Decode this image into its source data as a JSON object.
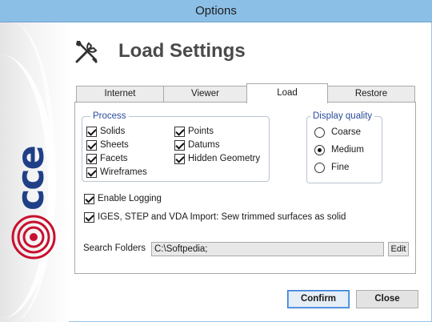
{
  "window": {
    "title": "Options"
  },
  "header": {
    "title": "Load Settings",
    "icon": "tools-icon"
  },
  "tabs": [
    {
      "label": "Internet",
      "active": false
    },
    {
      "label": "Viewer",
      "active": false
    },
    {
      "label": "Load",
      "active": true
    },
    {
      "label": "Restore",
      "active": false
    }
  ],
  "process": {
    "legend": "Process",
    "items": [
      {
        "label": "Solids",
        "checked": true
      },
      {
        "label": "Sheets",
        "checked": true
      },
      {
        "label": "Facets",
        "checked": true
      },
      {
        "label": "Wireframes",
        "checked": true
      },
      {
        "label": "Points",
        "checked": true
      },
      {
        "label": "Datums",
        "checked": true
      },
      {
        "label": "Hidden Geometry",
        "checked": true
      }
    ]
  },
  "display_quality": {
    "legend": "Display quality",
    "options": [
      {
        "label": "Coarse",
        "selected": false
      },
      {
        "label": "Medium",
        "selected": true
      },
      {
        "label": "Fine",
        "selected": false
      }
    ]
  },
  "options": {
    "enable_logging": {
      "label": "Enable Logging",
      "checked": true
    },
    "sew_trimmed": {
      "label": "IGES, STEP and VDA Import: Sew trimmed surfaces as solid",
      "checked": true
    }
  },
  "search": {
    "label": "Search Folders",
    "value": "C:\\Softpedia;",
    "edit_label": "Edit"
  },
  "buttons": {
    "confirm": "Confirm",
    "close": "Close"
  },
  "brand": {
    "logo_text": "cce"
  },
  "colors": {
    "title_bar": "#8bbfe6",
    "group_legend": "#2a4d9b",
    "logo_red": "#c8102e",
    "logo_blue": "#1f3f87"
  }
}
